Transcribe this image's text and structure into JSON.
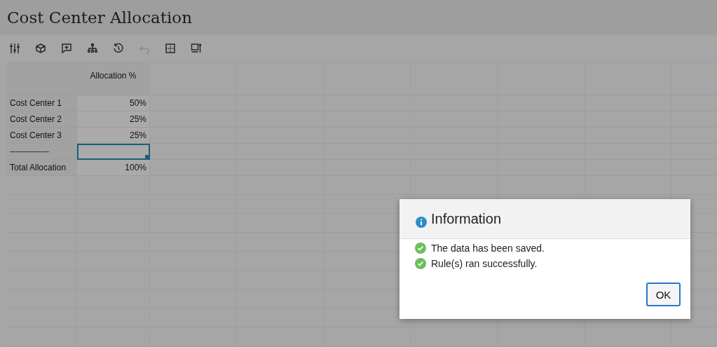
{
  "page": {
    "title": "Cost Center Allocation"
  },
  "toolbar": [
    {
      "kind": "sliders",
      "disabled": false
    },
    {
      "kind": "cube",
      "disabled": false
    },
    {
      "kind": "comment",
      "disabled": false
    },
    {
      "kind": "hierarchy",
      "disabled": false
    },
    {
      "kind": "history",
      "disabled": false
    },
    {
      "kind": "undo",
      "disabled": true
    },
    {
      "kind": "grid",
      "disabled": false
    },
    {
      "kind": "panel",
      "disabled": false
    }
  ],
  "table": {
    "column_header": "Allocation %",
    "rows": [
      {
        "label": "Cost Center 1",
        "value": "50%",
        "selected": false
      },
      {
        "label": "Cost Center 2",
        "value": "25%",
        "selected": false
      },
      {
        "label": "Cost Center 3",
        "value": "25%",
        "selected": false
      },
      {
        "label": "--------------",
        "selected": true
      },
      {
        "label": "Total Allocation",
        "value": "100%",
        "selected": false
      }
    ]
  },
  "dialog": {
    "title": "Information",
    "messages": [
      "The data has been saved.",
      "Rule(s) ran successfully."
    ],
    "button": "OK"
  }
}
